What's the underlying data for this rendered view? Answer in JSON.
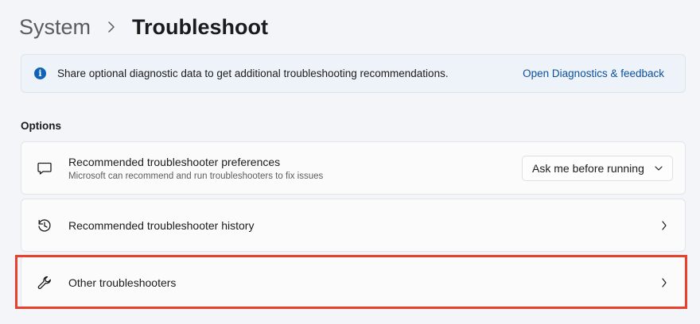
{
  "breadcrumb": {
    "parent": "System",
    "current": "Troubleshoot"
  },
  "info_bar": {
    "text": "Share optional diagnostic data to get additional troubleshooting recommendations.",
    "link": "Open Diagnostics & feedback"
  },
  "options": {
    "section_title": "Options",
    "items": [
      {
        "title": "Recommended troubleshooter preferences",
        "subtitle": "Microsoft can recommend and run troubleshooters to fix issues",
        "icon": "chat-bubble-icon",
        "dropdown_value": "Ask me before running"
      },
      {
        "title": "Recommended troubleshooter history",
        "icon": "history-icon"
      },
      {
        "title": "Other troubleshooters",
        "icon": "wrench-icon"
      }
    ]
  },
  "colors": {
    "accent": "#0f62b4",
    "link": "#0a4f9c",
    "highlight": "#e8402a"
  }
}
